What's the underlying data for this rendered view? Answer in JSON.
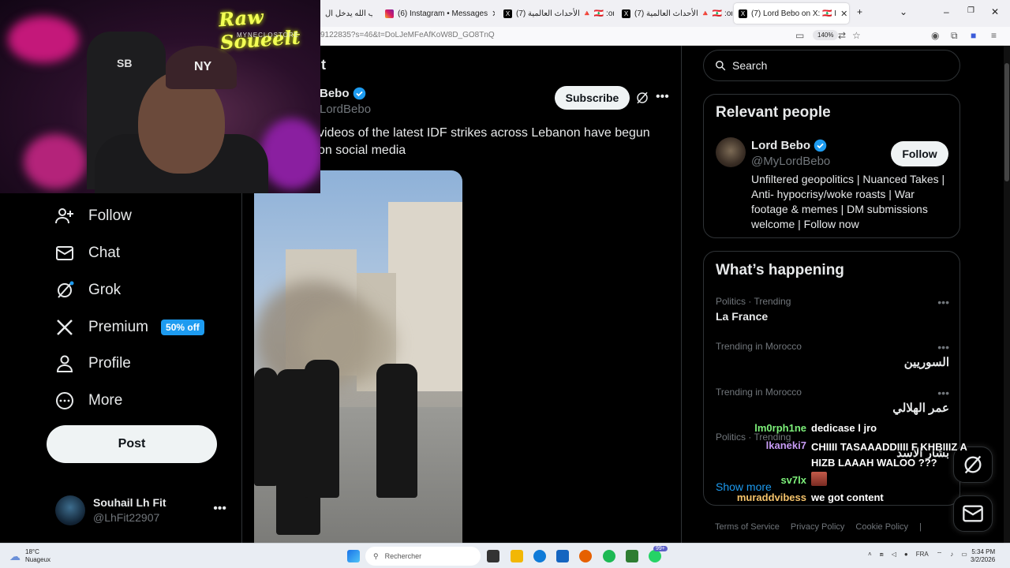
{
  "browser": {
    "tabs": [
      {
        "label": "حزب الله يدخل ال",
        "active": false
      },
      {
        "label": "(6) Instagram • Messages",
        "active": false
      },
      {
        "label": "(7) الأحداث العالمية 🔺 🇱🇧 :on X",
        "active": false
      },
      {
        "label": "(7) الأحداث العالمية 🔺 🇱🇧 :on X",
        "active": false
      },
      {
        "label": "(7) Lord Bebo on X: 🇱🇧 I",
        "active": true
      }
    ],
    "url": "9122835?s=46&t=DoLJeMFeAfKoW8D_GO8TnQ",
    "zoom": "140%"
  },
  "webcam": {
    "logo": "Raw Soueelt",
    "logo_sub": "MYNECLOSTORE",
    "cap_text": "NY",
    "chair_text": "SB"
  },
  "nav": {
    "items": [
      {
        "label": "Follow",
        "icon": "follow-icon"
      },
      {
        "label": "Chat",
        "icon": "chat-icon"
      },
      {
        "label": "Grok",
        "icon": "grok-icon"
      },
      {
        "label": "Premium",
        "icon": "x-icon",
        "badge": "50% off"
      },
      {
        "label": "Profile",
        "icon": "profile-icon"
      },
      {
        "label": "More",
        "icon": "more-icon"
      }
    ],
    "post_label": "Post",
    "account": {
      "name": "Souhail Lh Fit",
      "handle": "@LhFit22907"
    }
  },
  "post": {
    "title": "t",
    "author_name": "Bebo",
    "author_handle": "LordBebo",
    "subscribe_label": "Subscribe",
    "text": "videos of the latest IDF strikes across Lebanon have begun on social media"
  },
  "sidebar": {
    "search_placeholder": "Search",
    "relevant": {
      "title": "Relevant people",
      "name": "Lord Bebo",
      "handle": "@MyLordBebo",
      "follow_label": "Follow",
      "bio": "Unfiltered geopolitics | Nuanced Takes | Anti- hypocrisy/woke roasts | War footage & memes | DM submissions welcome | Follow now"
    },
    "happening": {
      "title": "What’s happening",
      "trends": [
        {
          "context": "Politics · Trending",
          "topic": "La France"
        },
        {
          "context": "Trending in Morocco",
          "topic": "السوريين"
        },
        {
          "context": "Trending in Morocco",
          "topic": "عمر الهلالي"
        },
        {
          "context": "Politics · Trending",
          "topic": "بشار الأسد"
        }
      ],
      "show_more": "Show more"
    },
    "footer": [
      "Terms of Service",
      "Privacy Policy",
      "Cookie Policy",
      "|"
    ]
  },
  "chat": [
    {
      "user": "lm0rph1ne",
      "color": "#7df07a",
      "message": "dedicase l jro"
    },
    {
      "user": "lkaneki7",
      "color": "#c89cf5",
      "message": "CHIIII TASAAADDIIII F KHBIIIZ A HIZB LAAAH WALOO ???"
    },
    {
      "user": "sv7lx",
      "color": "#7df07a",
      "message": ""
    },
    {
      "user": "muraddvibess",
      "color": "#f5c36b",
      "message": "we got content"
    }
  ],
  "taskbar": {
    "weather_temp": "18°C",
    "weather_desc": "Nuageux",
    "search_placeholder": "Rechercher",
    "lang": "FRA",
    "time": "5:34 PM",
    "date": "3/2/2026",
    "notification_badge": "99+"
  },
  "colors": {
    "accent": "#1d9bf0",
    "background": "#000000",
    "muted": "#71767b"
  }
}
